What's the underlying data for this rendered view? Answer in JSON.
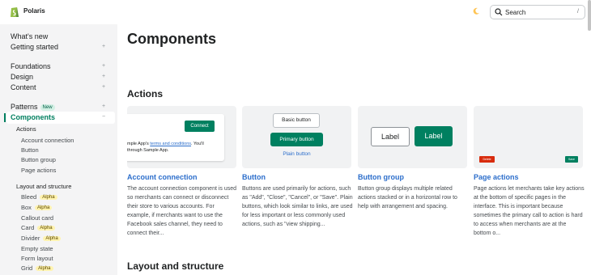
{
  "app": {
    "brand": "Polaris"
  },
  "search": {
    "label": "Search",
    "shortcut": "/"
  },
  "colors": {
    "accent": "#008060",
    "link": "#2c6ecb",
    "sidebar_bg": "#f4f4f5",
    "critical": "#d82c0d"
  },
  "sidebar": {
    "whats_new": "What's new",
    "getting_started": "Getting started",
    "foundations": "Foundations",
    "design": "Design",
    "content": "Content",
    "patterns": "Patterns",
    "patterns_badge": "New",
    "components": "Components",
    "plus": "+",
    "minus": "−",
    "actions_group": {
      "label": "Actions",
      "items": [
        "Account connection",
        "Button",
        "Button group",
        "Page actions"
      ]
    },
    "layout_group": {
      "label": "Layout and structure",
      "items": [
        {
          "label": "Bleed",
          "badge": "Alpha"
        },
        {
          "label": "Box",
          "badge": "Alpha"
        },
        {
          "label": "Callout card",
          "badge": ""
        },
        {
          "label": "Card",
          "badge": "Alpha"
        },
        {
          "label": "Divider",
          "badge": "Alpha"
        },
        {
          "label": "Empty state",
          "badge": ""
        },
        {
          "label": "Form layout",
          "badge": ""
        },
        {
          "label": "Grid",
          "badge": "Alpha"
        }
      ]
    }
  },
  "main": {
    "title": "Components",
    "sections": {
      "actions": "Actions",
      "layout": "Layout and structure"
    },
    "cards": [
      {
        "title": "Account connection",
        "description": "The account connection component is used so merchants can connect or disconnect their store to various accounts. For example, if merchants want to use the Facebook sales channel, they need to connect their...",
        "preview": {
          "connect": "Connect",
          "line1_pre": "mple App's ",
          "line1_link": "terms and conditions",
          "line1_post": ". You'll",
          "line2": "through Sample App."
        }
      },
      {
        "title": "Button",
        "description": "Buttons are used primarily for actions, such as \"Add\", \"Close\", \"Cancel\", or \"Save\". Plain buttons, which look similar to links, are used for less important or less commonly used actions, such as \"view shipping...",
        "preview": {
          "basic": "Basic button",
          "primary": "Primary button",
          "plain": "Plain button"
        }
      },
      {
        "title": "Button group",
        "description": "Button group displays multiple related actions stacked or in a horizontal row to help with arrangement and spacing.",
        "preview": {
          "label1": "Label",
          "label2": "Label"
        }
      },
      {
        "title": "Page actions",
        "description": "Page actions let merchants take key actions at the bottom of specific pages in the interface. This is important because sometimes the primary call to action is hard to access when merchants are at the bottom o...",
        "preview": {
          "delete": "Delete",
          "save": "Save"
        }
      }
    ]
  }
}
